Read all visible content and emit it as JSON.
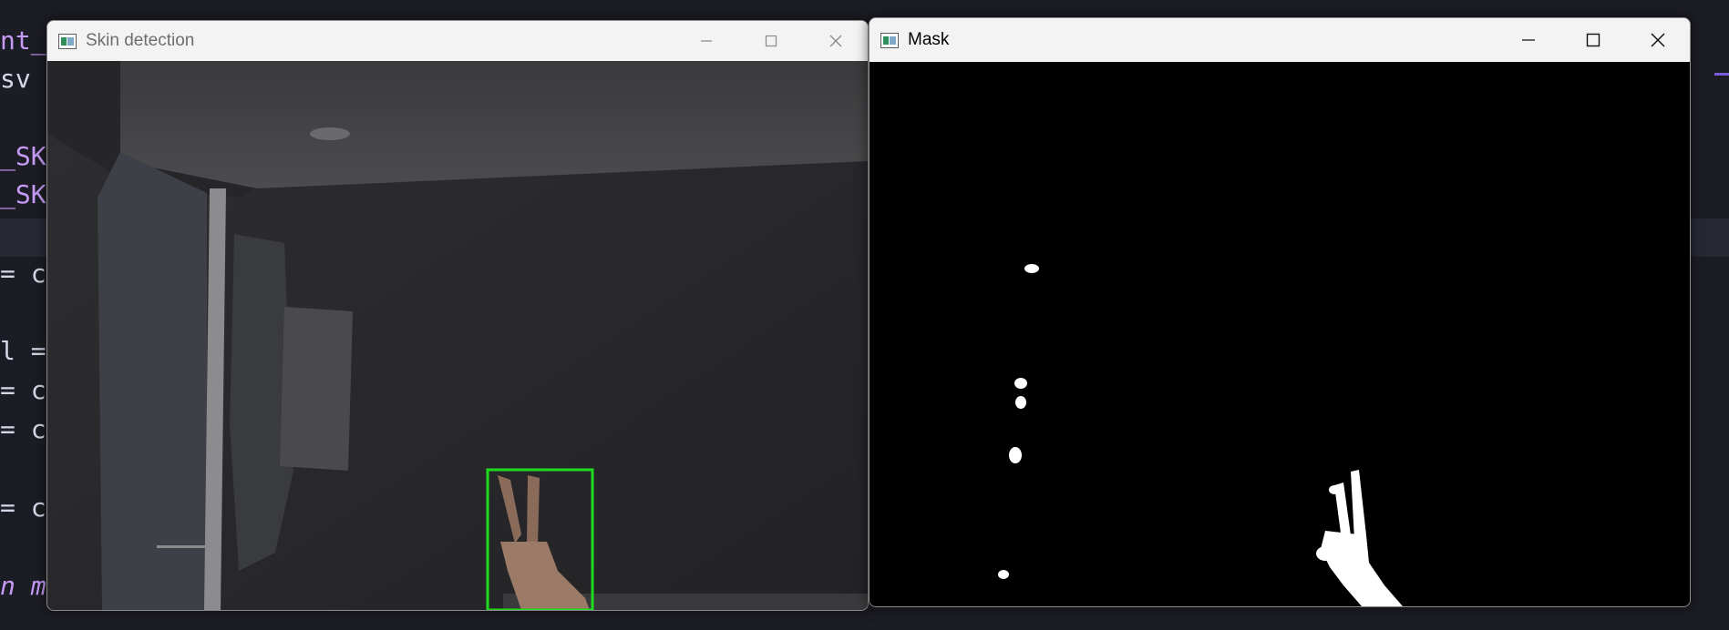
{
  "editor": {
    "lines": [
      "nt_s",
      "sv =",
      "_SKI",
      "_SKI",
      "= cv",
      "l =",
      "= cv",
      "= cv",
      "= cv",
      "n ma"
    ]
  },
  "windows": {
    "skin": {
      "title": "Skin detection",
      "icon": "window-app-icon"
    },
    "mask": {
      "title": "Mask",
      "icon": "window-app-icon"
    }
  },
  "colors": {
    "bounding_box": "#1fdc1f",
    "editor_keyword": "#c59bf5",
    "editor_text": "#d6d6e6"
  }
}
